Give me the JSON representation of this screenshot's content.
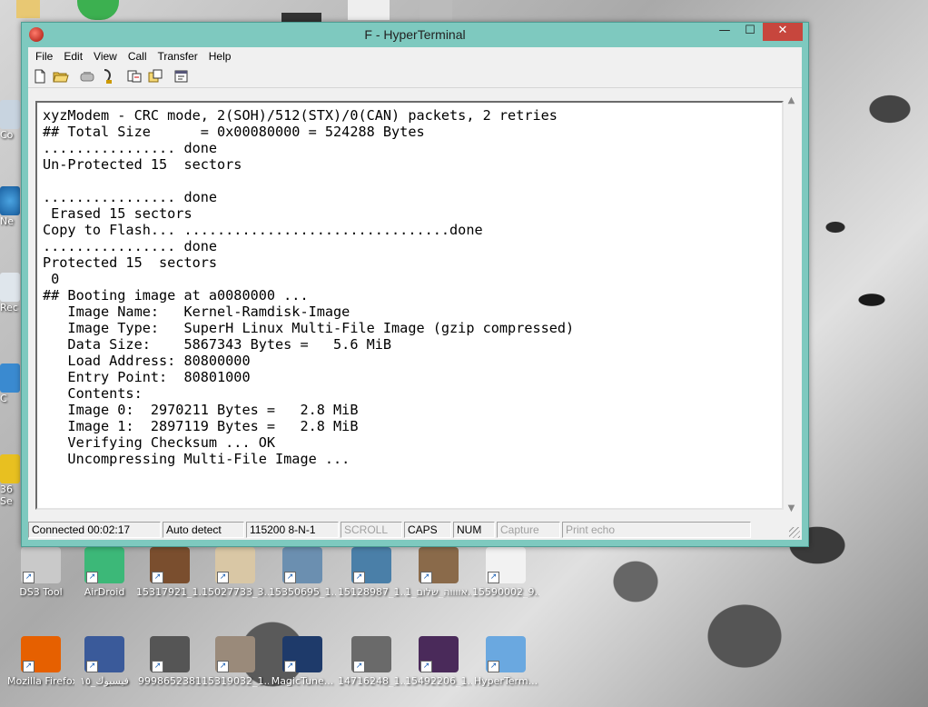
{
  "window": {
    "title": "F - HyperTerminal",
    "controls": {
      "minimize": "—",
      "maximize": "☐",
      "close": "✕"
    }
  },
  "menu": [
    "File",
    "Edit",
    "View",
    "Call",
    "Transfer",
    "Help"
  ],
  "toolbar": [
    "new-icon",
    "open-icon",
    "disconnect-icon",
    "connect-icon",
    "send-icon",
    "receive-icon",
    "properties-icon"
  ],
  "terminal": {
    "lines": [
      "xyzModem - CRC mode, 2(SOH)/512(STX)/0(CAN) packets, 2 retries",
      "## Total Size      = 0x00080000 = 524288 Bytes",
      "................ done",
      "Un-Protected 15  sectors",
      "",
      "................ done",
      " Erased 15 sectors",
      "Copy to Flash... ................................done",
      "................ done",
      "Protected 15  sectors",
      " 0",
      "## Booting image at a0080000 ...",
      "   Image Name:   Kernel-Ramdisk-Image",
      "   Image Type:   SuperH Linux Multi-File Image (gzip compressed)",
      "   Data Size:    5867343 Bytes =   5.6 MiB",
      "   Load Address: 80800000",
      "   Entry Point:  80801000",
      "   Contents:",
      "   Image 0:  2970211 Bytes =   2.8 MiB",
      "   Image 1:  2897119 Bytes =   2.8 MiB",
      "   Verifying Checksum ... OK",
      "   Uncompressing Multi-File Image ..."
    ]
  },
  "status": {
    "connected": "Connected 00:02:17",
    "detect": "Auto detect",
    "settings": "115200 8-N-1",
    "scroll": "SCROLL",
    "caps": "CAPS",
    "num": "NUM",
    "capture": "Capture",
    "print_echo": "Print echo"
  },
  "desktop": {
    "edge_labels": [
      "Co",
      "Ne",
      "Rec",
      "C",
      "36 Se"
    ],
    "row1": [
      {
        "label": "DS3 Tool",
        "color": "#c9c9c9"
      },
      {
        "label": "AirDroid",
        "color": "#3cb878"
      },
      {
        "label": "15317921_1...",
        "color": "#7a4e2e"
      },
      {
        "label": "15027733_3...",
        "color": "#d9c7a5"
      },
      {
        "label": "15350695_1...",
        "color": "#6b8fb0"
      },
      {
        "label": "15128987_1...",
        "color": "#4a7fa8"
      },
      {
        "label": "אווווה_שלום_1...",
        "color": "#8a6a4a"
      },
      {
        "label": "15590002_9...",
        "color": "#f2f2f2"
      }
    ],
    "row2": [
      {
        "label": "Mozilla Firefox",
        "color": "#e66000"
      },
      {
        "label": "فيسبوك_١٥",
        "color": "#3a5a9a"
      },
      {
        "label": "9998652381",
        "color": "#555555"
      },
      {
        "label": "15319032_1...",
        "color": "#9a8a7a"
      },
      {
        "label": "MagicTune...",
        "color": "#1e3a6a"
      },
      {
        "label": "14716248_1...",
        "color": "#6a6a6a"
      },
      {
        "label": "15492206_1...",
        "color": "#4a2a5a"
      },
      {
        "label": "HyperTerm...",
        "color": "#6aa8e0"
      }
    ]
  }
}
